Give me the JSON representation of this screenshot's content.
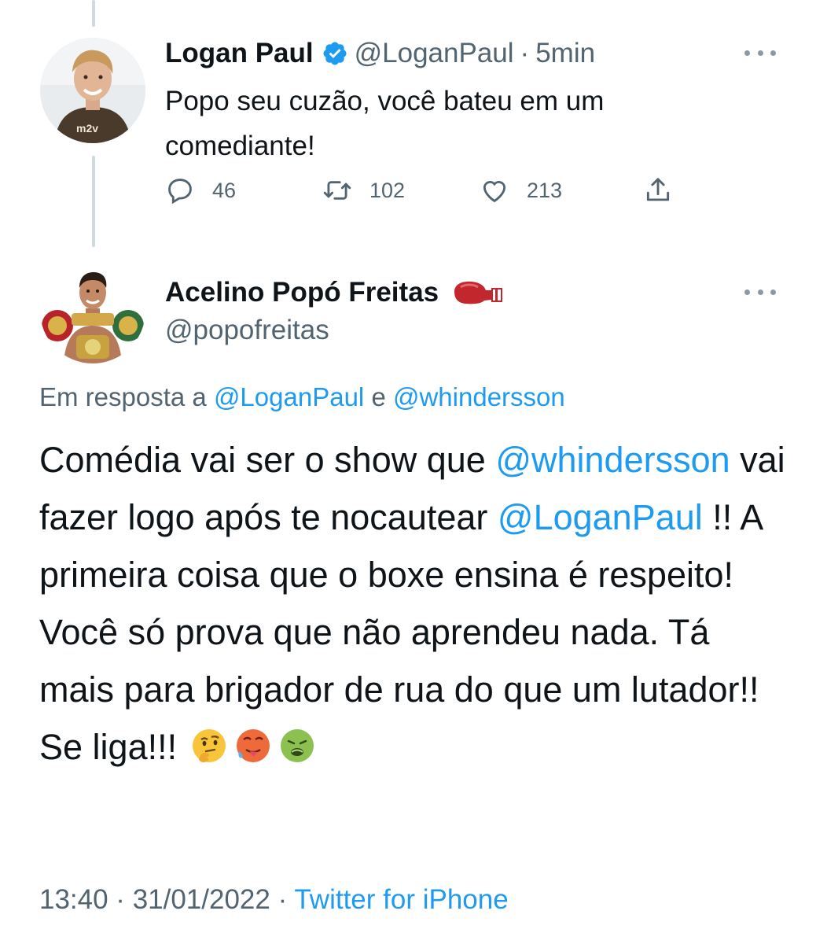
{
  "tweet1": {
    "name": "Logan Paul",
    "handle": "@LoganPaul",
    "separator": "·",
    "time": "5min",
    "text": "Popo seu cuzão, você bateu em um comediante!",
    "actions": {
      "replies": "46",
      "retweets": "102",
      "likes": "213"
    },
    "icons": {
      "verified": "verified-badge-icon",
      "reply": "reply-icon",
      "retweet": "retweet-icon",
      "like": "heart-icon",
      "share": "share-icon",
      "more": "more-icon"
    }
  },
  "tweet2": {
    "name": "Acelino Popó Freitas",
    "handle": "@popofreitas",
    "reply_prefix": "Em resposta a",
    "reply_mention_1": "@LoganPaul",
    "reply_conj": "e",
    "reply_mention_2": "@whindersson",
    "body": {
      "p1": "Comédia vai ser o show que ",
      "m1": "@whindersson",
      "p2": " vai fazer logo após te nocautear ",
      "m2": "@LoganPaul",
      "p3": " !! A primeira coisa que o boxe ensina é respeito! Você só prova que não aprendeu nada. Tá mais para brigador de rua do que um lutador!! Se liga!!!"
    },
    "emojis": [
      "thinking-face-emoji",
      "hot-face-emoji",
      "nauseated-face-emoji"
    ],
    "timestamp": "13:40 · 31/01/2022 ·",
    "source": "Twitter for iPhone"
  },
  "colors": {
    "link": "#1d9bf0",
    "secondary_text": "#536471",
    "primary_text": "#0f1419",
    "verified": "#1d9bf0",
    "thread_line": "#cfd9de"
  }
}
